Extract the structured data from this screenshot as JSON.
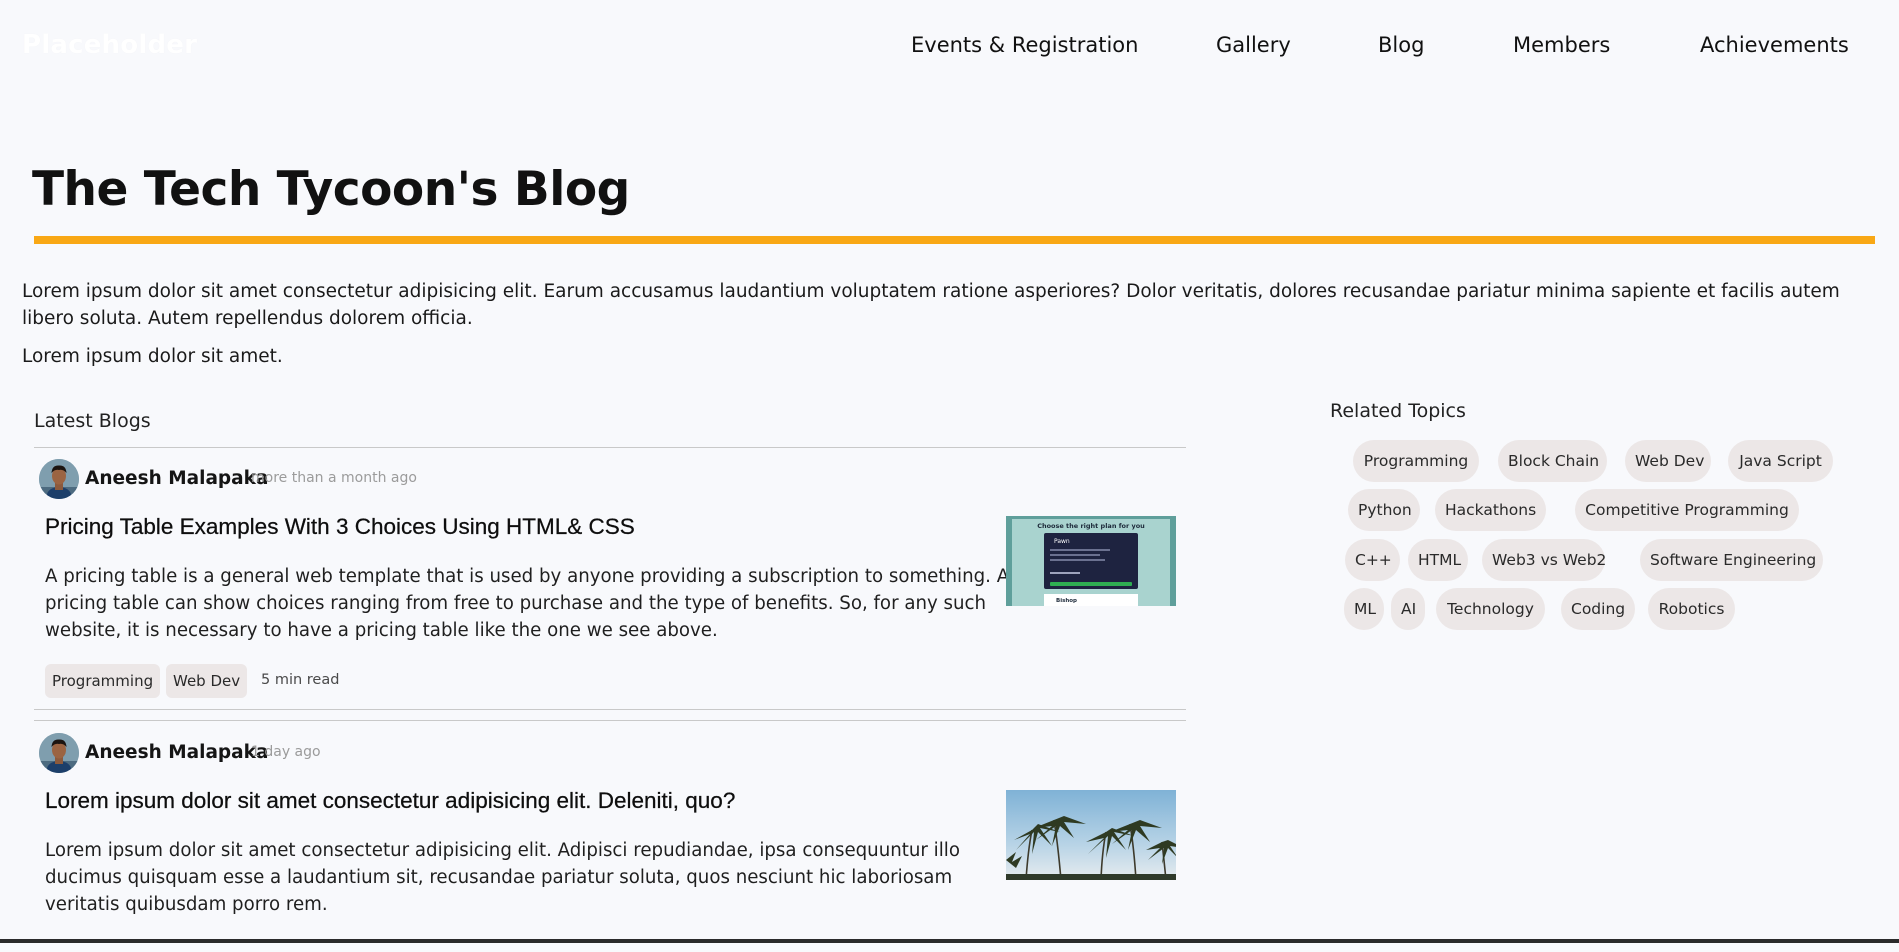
{
  "header": {
    "logo": "Placeholder",
    "nav": [
      "Events & Registration",
      "Gallery",
      "Blog",
      "Members",
      "Achievements"
    ]
  },
  "page": {
    "title": "The Tech Tycoon's Blog",
    "accent_color": "#f9a815",
    "intro": "Lorem ipsum dolor sit amet consectetur adipisicing elit. Earum accusamus laudantium voluptatem ratione asperiores? Dolor veritatis, dolores recusandae pariatur minima sapiente et facilis autem libero soluta. Autem repellendus dolorem officia.",
    "intro_2": "Lorem ipsum dolor sit amet."
  },
  "latest": {
    "heading": "Latest Blogs",
    "posts": [
      {
        "author": "Aneesh Malapaka",
        "time": "more than a month ago",
        "title": "Pricing Table Examples With 3 Choices Using HTML& CSS",
        "excerpt": "A pricing table is a general web template that is used by anyone providing a subscription to something. A pricing table can show choices ranging from free to purchase and the type of benefits. So, for any such website, it is necessary to have a pricing table like the one we see above.",
        "tags": [
          "Programming",
          "Web Dev"
        ],
        "read_time": "5 min read",
        "thumbnail": "pricing-table-image"
      },
      {
        "author": "Aneesh Malapaka",
        "time": "1 day ago",
        "title": "Lorem ipsum dolor sit amet consectetur adipisicing elit. Deleniti, quo?",
        "excerpt": "Lorem ipsum dolor sit amet consectetur adipisicing elit. Adipisci repudiandae, ipsa consequuntur illo ducimus quisquam esse a laudantium sit, recusandae pariatur soluta, quos nesciunt hic laboriosam veritatis quibusdam porro rem.",
        "tags": [],
        "read_time": "",
        "thumbnail": "palm-trees-image"
      }
    ]
  },
  "related": {
    "heading": "Related Topics",
    "topics": [
      "Programming",
      "Block Chain",
      "Web Dev",
      "Java Script",
      "Python",
      "Hackathons",
      "Competitive Programming",
      "C++",
      "HTML",
      "Web3 vs Web2",
      "Software Engineering",
      "ML",
      "AI",
      "Technology",
      "Coding",
      "Robotics"
    ]
  },
  "thumb_text": {
    "pricing_heading": "Choose the right plan for you",
    "pricing_plan": "Pawn",
    "pricing_plan_2": "Bishop"
  }
}
